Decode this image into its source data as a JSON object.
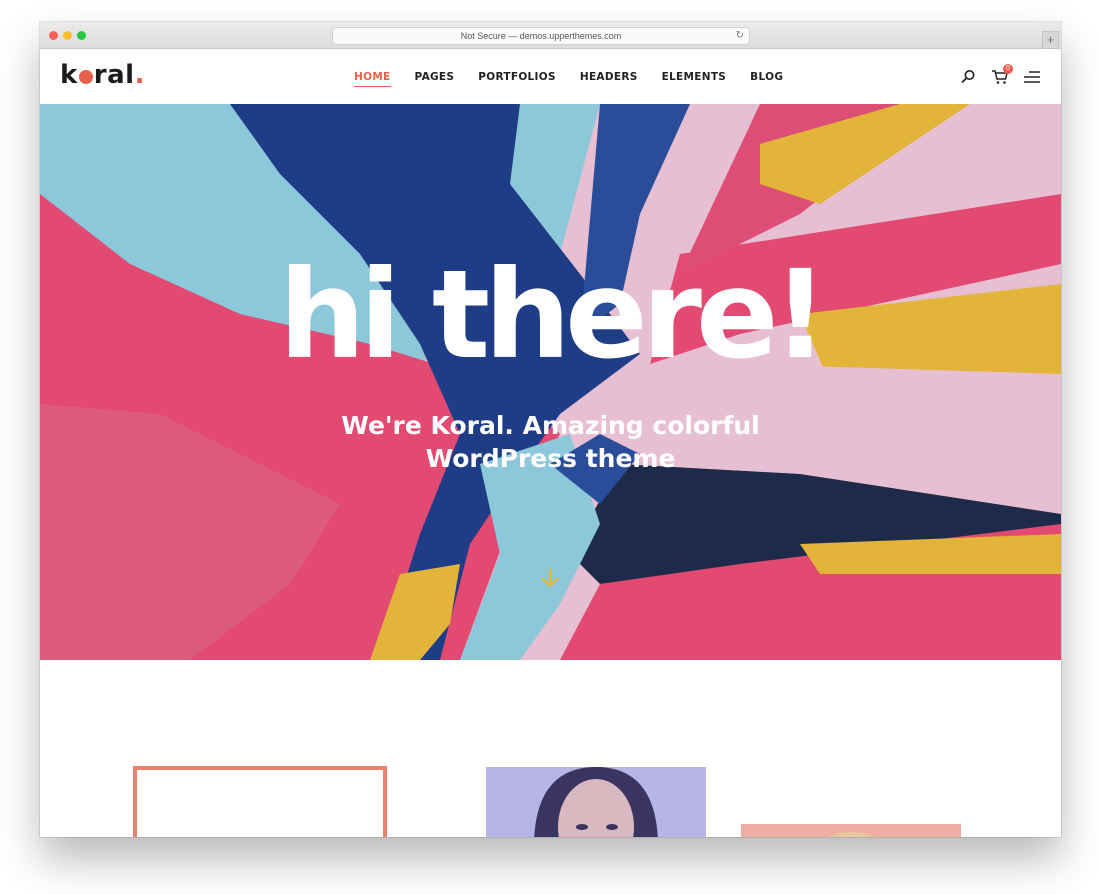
{
  "browser": {
    "url_text": "Not Secure — demos.upperthemes.com",
    "reload_icon": "reload-icon",
    "newtab_label": "+"
  },
  "logo": {
    "text_before": "k",
    "text_after": "ral",
    "dot": "."
  },
  "nav": {
    "items": [
      {
        "label": "HOME",
        "active": true
      },
      {
        "label": "PAGES"
      },
      {
        "label": "PORTFOLIOS"
      },
      {
        "label": "HEADERS"
      },
      {
        "label": "ELEMENTS"
      },
      {
        "label": "BLOG"
      }
    ]
  },
  "header_icons": {
    "search": "search-icon",
    "cart": "cart-icon",
    "cart_count": "0",
    "menu": "menu-icon"
  },
  "hero": {
    "title": "hi there!",
    "subtitle_line1": "We're Koral. Amazing colorful",
    "subtitle_line2": "WordPress theme",
    "scroll_icon": "arrow-down-icon"
  },
  "colors": {
    "accent": "#e8604c",
    "paint_pink": "#e24a72",
    "paint_blue": "#1f3c86",
    "paint_light_blue": "#8cc8da",
    "paint_yellow": "#e2b53a",
    "paint_lilac": "#e7bfd2",
    "paint_navy": "#1e2a4a"
  }
}
